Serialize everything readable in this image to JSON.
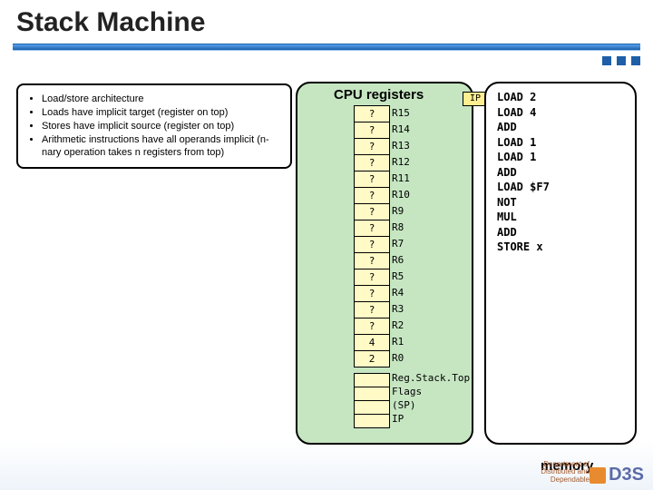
{
  "title": "Stack Machine",
  "bullets": [
    "Load/store architecture",
    "Loads have implicit target (register on top)",
    "Stores have implicit source (register on top)",
    "Arithmetic instructions have all operands implicit (n-nary operation takes n registers from top)"
  ],
  "cpu": {
    "heading": "CPU registers",
    "registers": [
      {
        "value": "?",
        "name": "R15"
      },
      {
        "value": "?",
        "name": "R14"
      },
      {
        "value": "?",
        "name": "R13"
      },
      {
        "value": "?",
        "name": "R12"
      },
      {
        "value": "?",
        "name": "R11"
      },
      {
        "value": "?",
        "name": "R10"
      },
      {
        "value": "?",
        "name": "R9"
      },
      {
        "value": "?",
        "name": "R8"
      },
      {
        "value": "?",
        "name": "R7"
      },
      {
        "value": "?",
        "name": "R6"
      },
      {
        "value": "?",
        "name": "R5"
      },
      {
        "value": "?",
        "name": "R4"
      },
      {
        "value": "?",
        "name": "R3"
      },
      {
        "value": "?",
        "name": "R2"
      },
      {
        "value": "4",
        "name": "R1"
      },
      {
        "value": "2",
        "name": "R0"
      }
    ],
    "extra_labels": [
      "Reg.Stack.Top",
      "Flags",
      "(SP)",
      "IP"
    ]
  },
  "ip_tag": "IP",
  "memory": {
    "label": "memory",
    "code": [
      "LOAD 2",
      "LOAD 4",
      "ADD",
      "LOAD 1",
      "LOAD 1",
      "ADD",
      "LOAD $F7",
      "NOT",
      "MUL",
      "ADD",
      "STORE x"
    ]
  },
  "footer": {
    "dept": "Department of\nDistributed and\nDependable",
    "logo": "D3S"
  }
}
